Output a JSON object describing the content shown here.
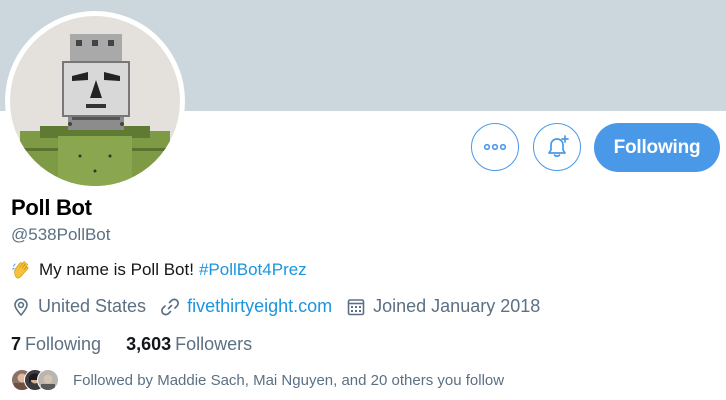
{
  "profile": {
    "name": "Poll Bot",
    "handle": "@538PollBot",
    "bio_text": "My name is Poll Bot!",
    "bio_hashtag": "#PollBot4Prez",
    "location": "United States",
    "website": "fivethirtyeight.com",
    "joined": "Joined January 2018"
  },
  "stats": {
    "following_count": "7",
    "following_label": "Following",
    "followers_count": "3,603",
    "followers_label": "Followers"
  },
  "actions": {
    "follow_button_label": "Following"
  },
  "followed_by": "Followed by Maddie Sach, Mai Nguyen, and 20 others you follow",
  "icons": {
    "more": "more-options-icon",
    "notify": "bell-plus-icon",
    "location": "location-pin-icon",
    "link": "link-icon",
    "calendar": "calendar-icon",
    "bio_emoji": "waving-hand-icon"
  },
  "colors": {
    "accent": "#4a99e9",
    "link": "#1b95e0",
    "secondary_text": "#5b7083",
    "banner": "#ccd6dd"
  }
}
